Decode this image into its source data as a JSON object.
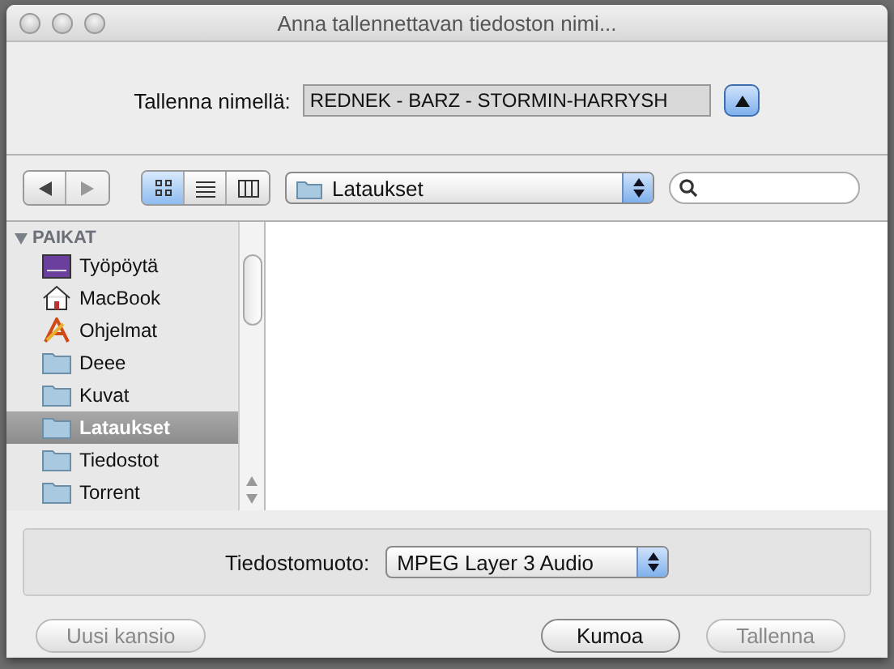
{
  "window": {
    "title": "Anna tallennettavan tiedoston nimi..."
  },
  "filename": {
    "label": "Tallenna nimellä:",
    "value": "REDNEK - BARZ - STORMIN-HARRYSH",
    "expanded": false
  },
  "toolbar": {
    "nav": [
      {
        "kind": "back",
        "disabled": false
      },
      {
        "kind": "forward",
        "disabled": true
      }
    ],
    "views": [
      {
        "kind": "icons",
        "selected": true
      },
      {
        "kind": "list",
        "selected": false
      },
      {
        "kind": "columns",
        "selected": false
      }
    ],
    "location": "Lataukset"
  },
  "sidebar": {
    "section": "PAIKAT",
    "expanded": true,
    "items": [
      {
        "label": "Työpöytä",
        "kind": "desktop",
        "selected": false
      },
      {
        "label": "MacBook",
        "kind": "home",
        "selected": false
      },
      {
        "label": "Ohjelmat",
        "kind": "apps",
        "selected": false
      },
      {
        "label": "Deee",
        "kind": "folder",
        "selected": false
      },
      {
        "label": "Kuvat",
        "kind": "folder",
        "selected": false
      },
      {
        "label": "Lataukset",
        "kind": "folder",
        "selected": true
      },
      {
        "label": "Tiedostot",
        "kind": "folder",
        "selected": false
      },
      {
        "label": "Torrent",
        "kind": "folder",
        "selected": false
      }
    ]
  },
  "format": {
    "label": "Tiedostomuoto:",
    "value": "MPEG Layer 3 Audio"
  },
  "buttons": [
    {
      "label": "Uusi kansio",
      "disabled": true
    },
    {
      "label": "Kumoa",
      "disabled": false
    },
    {
      "label": "Tallenna",
      "disabled": true
    }
  ]
}
